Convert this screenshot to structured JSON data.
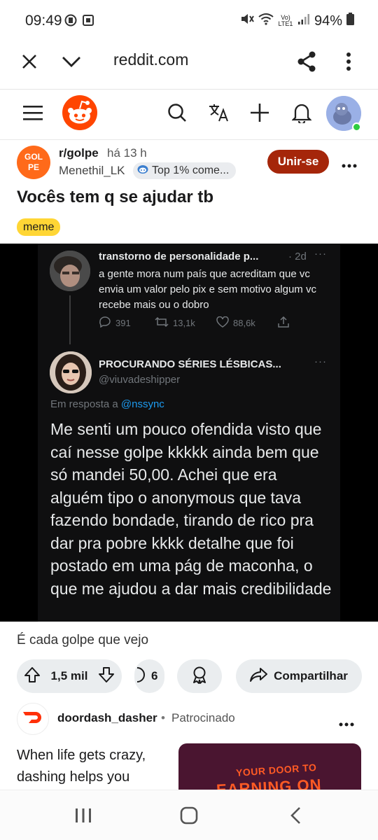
{
  "status_bar": {
    "time": "09:49",
    "battery": "94%",
    "network": "Vo) LTE1"
  },
  "browser": {
    "url": "reddit.com",
    "icons": [
      "close-icon",
      "chevron-down-icon",
      "share-icon",
      "more-vertical-icon"
    ]
  },
  "reddit_header": {
    "icons": [
      "menu-icon",
      "reddit-logo",
      "search-icon",
      "translate-icon",
      "plus-icon",
      "bell-icon",
      "user-avatar"
    ]
  },
  "post": {
    "subreddit": "r/golpe",
    "subreddit_icon_text": "GOL PE",
    "time_ago": "há 13 h",
    "username": "Menethil_LK",
    "user_flair": "Top 1% come...",
    "join_label": "Unir-se",
    "title": "Vocês tem q se ajudar tb",
    "flair": "meme",
    "body": "É cada golpe que vejo",
    "vote_count": "1,5 mil",
    "comment_count": "6",
    "share_label": "Compartilhar"
  },
  "tweet_image": {
    "tweet1": {
      "name": "transtorno de personalidade p...",
      "date": "· 2d",
      "text": "a gente mora num país que acreditam que vc envia um valor pelo pix e sem motivo algum vc recebe mais ou o dobro",
      "replies": "391",
      "retweets": "13,1k",
      "likes": "88,6k"
    },
    "tweet2": {
      "name": "PROCURANDO SÉRIES LÉSBICAS...",
      "handle": "@viuvadeshipper",
      "replying_prefix": "Em resposta a",
      "replying_to": "@nssync",
      "text": "Me senti um pouco ofendida visto que caí nesse golpe kkkkk ainda bem que só mandei 50,00. Achei que era alguém tipo o anonymous que tava fazendo bondade, tirando de rico pra dar pra pobre kkkk detalhe que foi postado em uma pág de maconha, o que me ajudou a dar mais credibilidade"
    }
  },
  "ad": {
    "name": "doordash_dasher",
    "separator": "•",
    "sponsored": "Patrocinado",
    "text": "When life gets crazy, dashing helps you",
    "image_line1": "YOUR DOOR TO",
    "image_line2": "EARNING ON"
  },
  "colors": {
    "reddit_orange": "#ff4500",
    "join_button": "#a5260a",
    "meme_flair": "#ffd635",
    "twitter_link": "#1d9bf0",
    "doordash_red": "#ff3008"
  }
}
